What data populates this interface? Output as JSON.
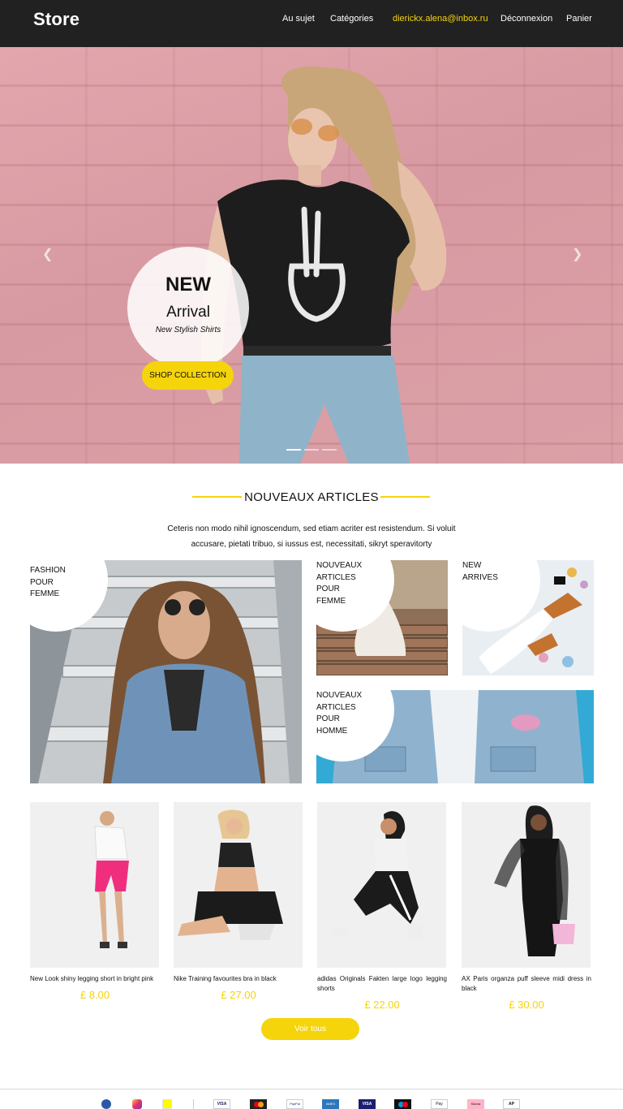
{
  "nav": {
    "brand": "Store",
    "links": [
      "Au sujet",
      "Catégories",
      "dierickx.alena@inbox.ru",
      "Déconnexion",
      "Panier"
    ]
  },
  "hero": {
    "headline": "NEW",
    "subheadline": "Arrival",
    "tagline": "New Stylish Shirts",
    "cta": "SHOP COLLECTION",
    "slide_count": 3,
    "active_slide": 1
  },
  "section": {
    "title": "NOUVEAUX ARTICLES",
    "description": "Ceteris non modo nihil ignoscendum, sed etiam acriter est resistendum. Si voluit accusare, pietati tribuo, si iussus est, necessitati, sikryt speravitorty"
  },
  "tiles": [
    {
      "label": "FASHION POUR FEMME"
    },
    {
      "label": "NOUVEAUX ARTICLES POUR FEMME"
    },
    {
      "label": "NEW ARRIVES"
    },
    {
      "label": "NOUVEAUX ARTICLES POUR HOMME"
    }
  ],
  "products": [
    {
      "name": "New Look shiny legging short in bright pink",
      "price": "£ 8.00"
    },
    {
      "name": "Nike Training favourites bra in black",
      "price": "£ 27.00"
    },
    {
      "name": "adidas Originals Fakten large logo legging shorts",
      "price": "£ 22.00"
    },
    {
      "name": "AX Paris organza puff sleeve midi dress in black",
      "price": "£ 30.00"
    }
  ],
  "view_all": "Voir tous",
  "footer": {
    "social": [
      "facebook-icon",
      "instagram-icon",
      "snapchat-icon"
    ],
    "payments": [
      "VISA",
      "mastercard",
      "PayPal",
      "AMEX",
      "VISA",
      "maestro",
      "Pay",
      "Klarna",
      "AP"
    ]
  },
  "colors": {
    "accent": "#f5d40b",
    "nav_bg": "#212121"
  }
}
